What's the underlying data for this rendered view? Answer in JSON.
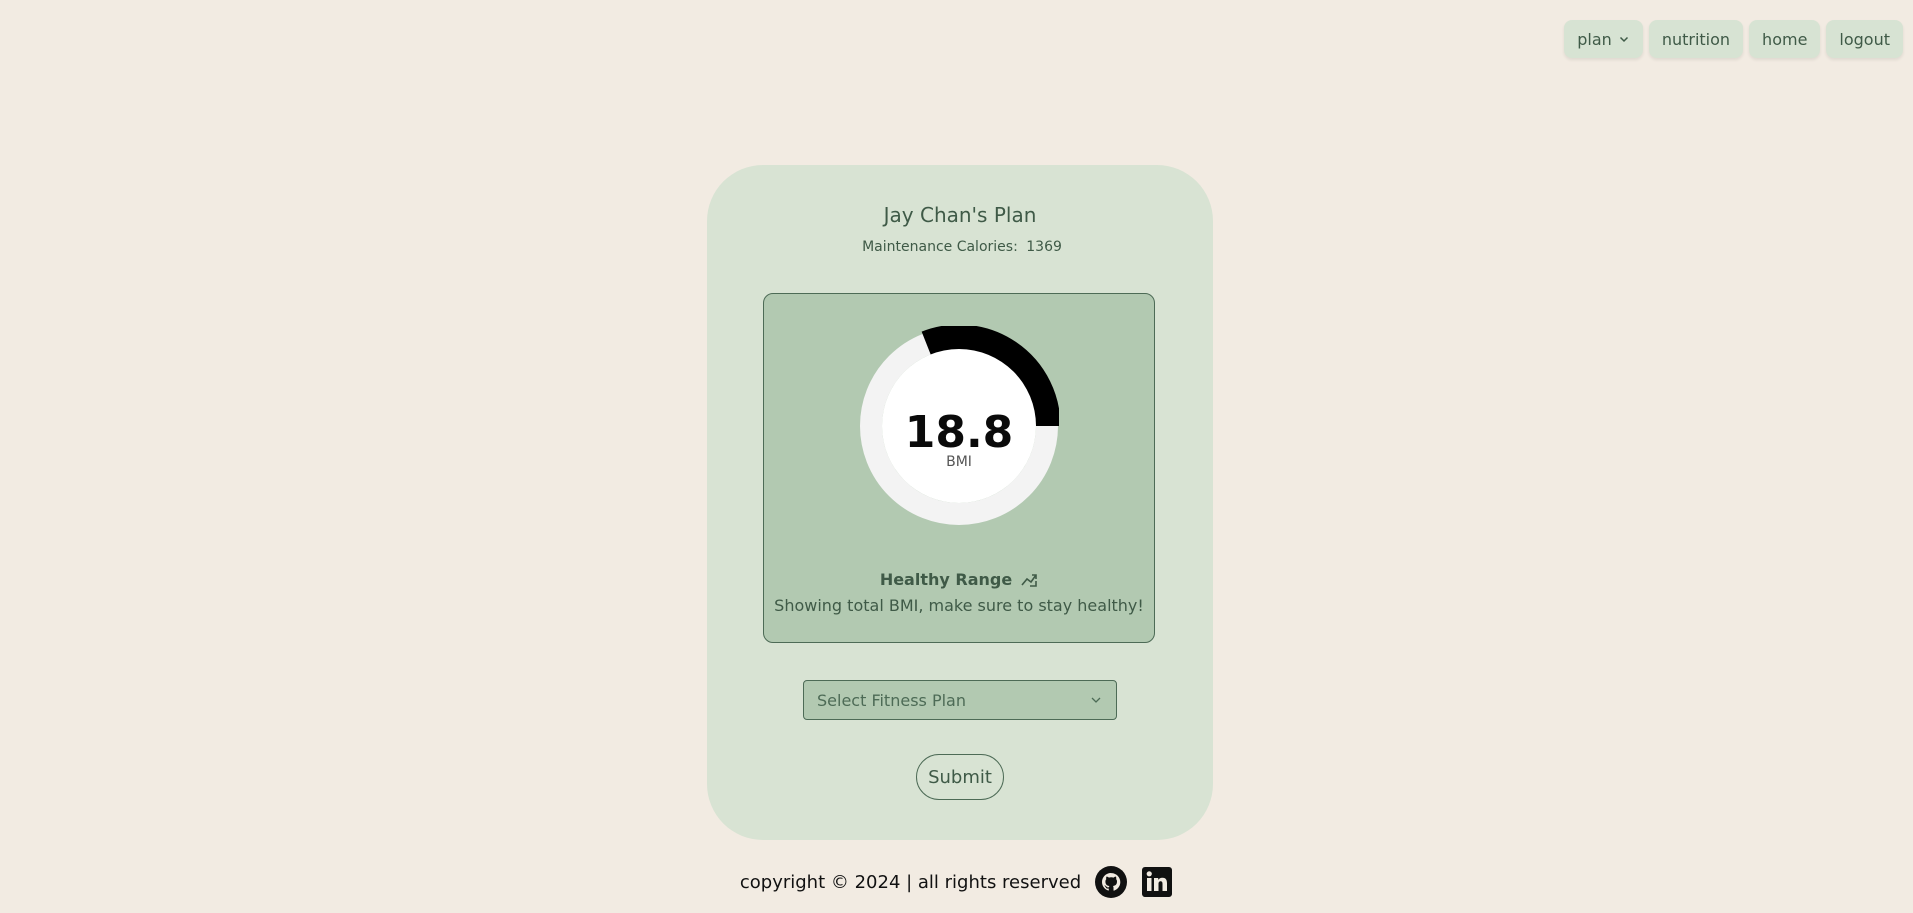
{
  "nav": {
    "plan": "plan",
    "nutrition": "nutrition",
    "home": "home",
    "logout": "logout"
  },
  "card": {
    "title": "Jay Chan's Plan",
    "maintenance_label": "Maintenance Calories:",
    "maintenance_value": "1369"
  },
  "bmi": {
    "value": "18.8",
    "label": "BMI",
    "range_title": "Healthy Range",
    "note": "Showing total BMI, make sure to stay healthy!",
    "gauge_fill_fraction": 0.31
  },
  "form": {
    "select_placeholder": "Select Fitness Plan",
    "submit_label": "Submit"
  },
  "footer": {
    "text": "copyright © 2024 | all rights reserved"
  },
  "icons": {
    "dropdown": "chevron-down-icon",
    "trend": "trending-icon",
    "github": "github-icon",
    "linkedin": "linkedin-icon"
  },
  "colors": {
    "background": "#f2ebe2",
    "card": "#d8e3d3",
    "bmi_box": "#b2c9b1",
    "accent_text": "#3f5a47",
    "gauge_fill": "#000000",
    "gauge_track": "#f3f3f3"
  }
}
